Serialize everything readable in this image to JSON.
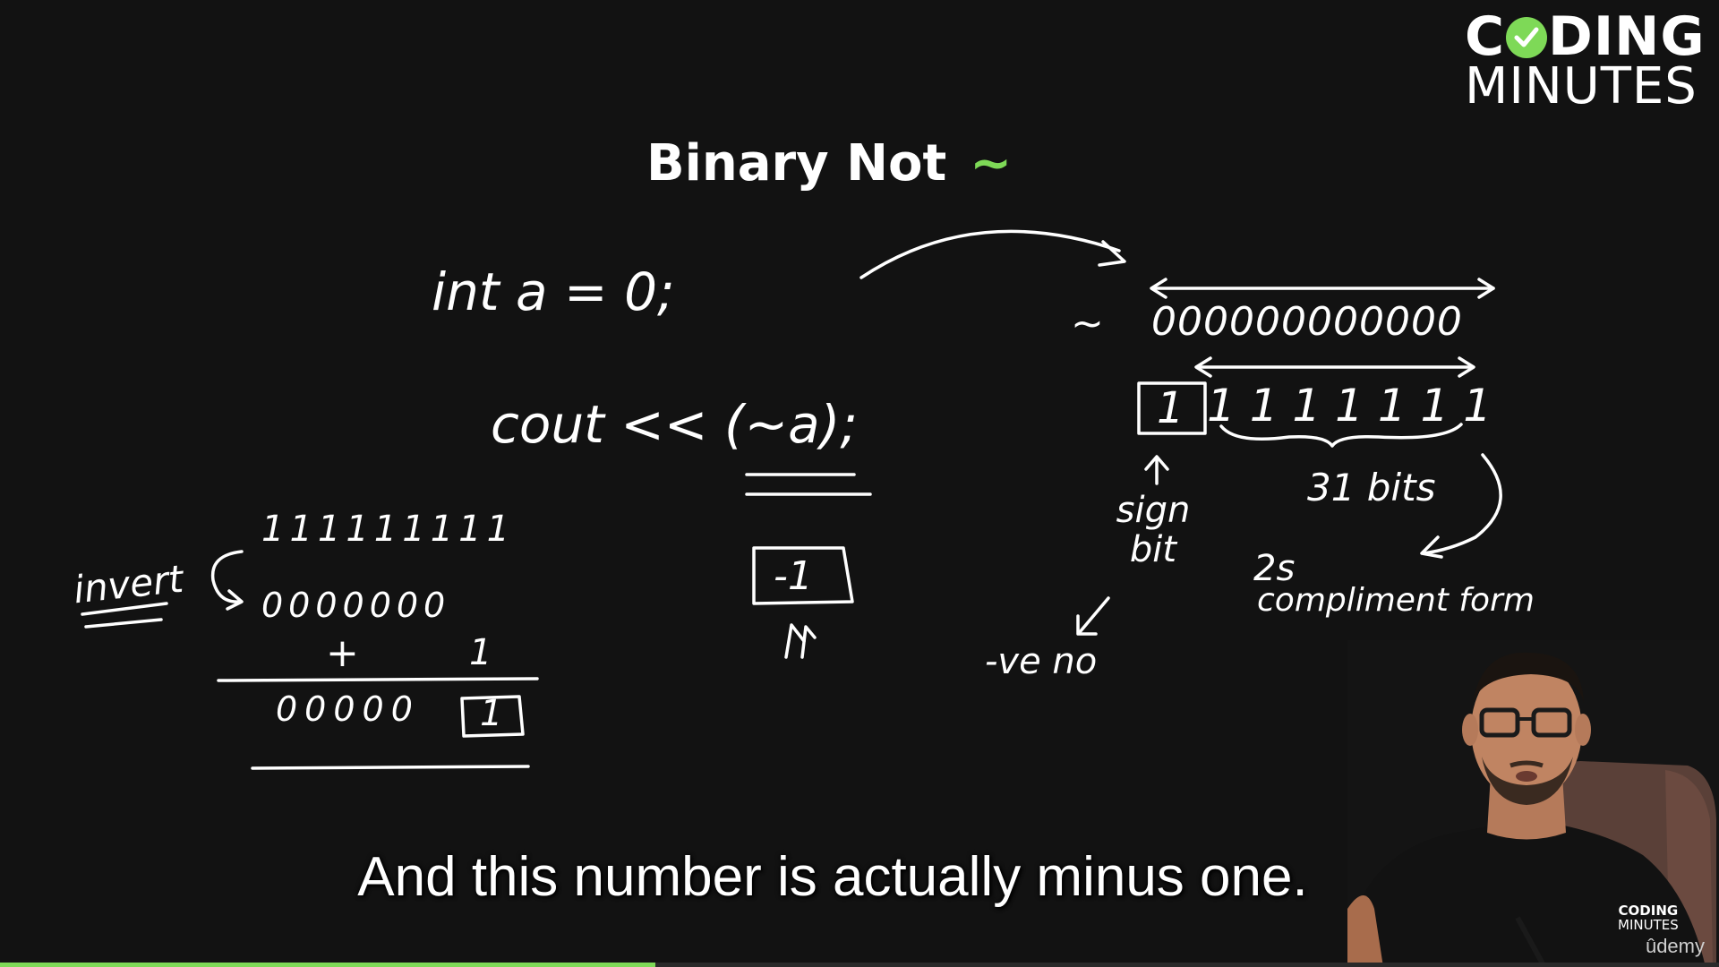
{
  "logo": {
    "line1_pre": "C",
    "line1_post": "DING",
    "line2": "MINUTES"
  },
  "slide": {
    "title": "Binary Not",
    "title_symbol": "~",
    "accent_color": "#7ed957"
  },
  "whiteboard": {
    "declaration": "int a = 0;",
    "cout_line": "cout << (~a);",
    "result": "-1",
    "tilde_mark": "~",
    "zeros_row": "000000000000",
    "ones_box": "1",
    "ones_row": "1 1 1 1 1 1 1",
    "sign_bit_label": "sign bit",
    "bits_label": "31 bits",
    "twos_label_1": "2s",
    "twos_label_2": "compliment form",
    "negative_label": "-ve no",
    "invert_label": "invert",
    "ones_top": "111111111",
    "zeros_mid": "0000000",
    "plus_sign": "+",
    "plus_one": "1",
    "sum_zeros": "00000",
    "sum_box": "1"
  },
  "presenter": {
    "shirt_logo_1": "CODING",
    "shirt_logo_2": "MINUTES"
  },
  "subtitle": "And this number is actually minus one.",
  "watermark": "ûdemy",
  "progress": {
    "fraction": 0.381
  }
}
